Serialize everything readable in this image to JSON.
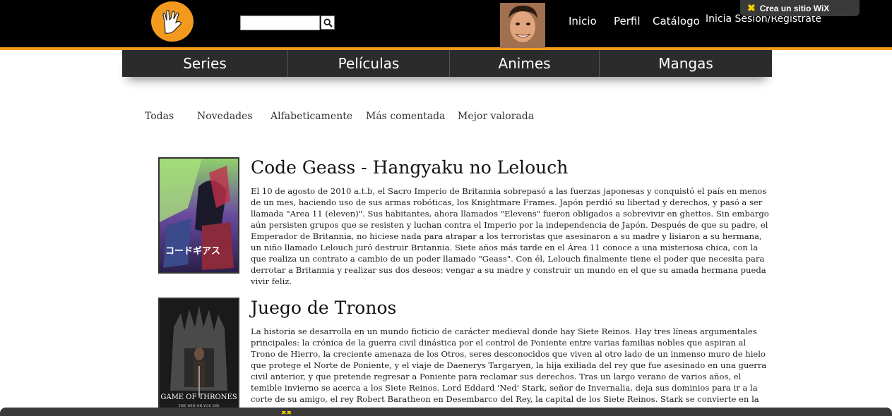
{
  "header": {
    "logo_icon": "vulcan-salute-icon",
    "search": {
      "placeholder": "",
      "value": ""
    },
    "search_icon": "search-icon",
    "avatar_icon": "user-avatar",
    "nav": {
      "inicio": "Inicio",
      "perfil": "Perfil",
      "catalogo": "Catálogo",
      "login": "Inicia Sesión/Regístrate"
    },
    "wix_badge": "Crea un sitio WiX"
  },
  "categories": [
    "Series",
    "Películas",
    "Animes",
    "Mangas"
  ],
  "filters": [
    "Todas",
    "Novedades",
    "Alfabeticamente",
    "Más comentada",
    "Mejor valorada"
  ],
  "entries": [
    {
      "title": "Code Geass - Hangyaku no Lelouch",
      "description": "El 10 de agosto de 2010 a.t.b, el Sacro Imperio de Britannia sobrepasó a las fuerzas japonesas y conquistó el país en menos de un mes, haciendo uso de sus armas robóticas, los Knightmare Frames. Japón perdió su libertad y derechos, y pasó a ser llamada \"Area 11 (eleven)\". Sus habitantes, ahora llamados \"Elevens\" fueron obligados a sobrevivir en ghettos. Sin embargo aún persisten grupos que se resisten y luchan contra el Imperio por la independencia de Japón. Después de que su padre, el Emperador de Britannia, no hiciese nada para atrapar a los terroristas que asesinaron a su madre y lisiaron a su hermana, un niño llamado Lelouch juró destruir Britannia. Siete años más tarde en el Área 11 conoce a una misteriosa chica, con la que realiza un contrato a cambio de un poder llamado \"Geass\". Con él, Lelouch finalmente tiene el poder que necesita para derrotar a Britannia y realizar sus dos deseos: vengar a su madre y construir un mundo en el que su amada hermana pueda vivir feliz."
    },
    {
      "title": "Juego de Tronos",
      "description": "La historia se desarrolla en un mundo ficticio de carácter medieval donde hay Siete Reinos. Hay tres líneas argumentales principales: la crónica de la guerra civil dinástica por el control de Poniente entre varias familias nobles que aspiran al Trono de Hierro, la creciente amenaza de los Otros, seres desconocidos que viven al otro lado de un inmenso muro de hielo que protege el Norte de Poniente, y el viaje de Daenerys Targaryen, la hija exiliada del rey que fue asesinado en una guerra civil anterior, y que pretende regresar a Poniente para reclamar sus derechos. Tras un largo verano de varios años, el temible invierno se acerca a los Siete Reinos. Lord Eddard 'Ned' Stark, señor de Invernalia, deja sus dominios para ir a la corte de su amigo, el rey Robert Baratheon en Desembarco del Rey, la capital de los Siete Reinos. Stark se convierte en la Mano del Rey e intenta desentrañar una maraña de intrigas que pondrá en peligro su vida y la de",
      "poster_text": "GAME OF THRONES",
      "poster_subtext": "THE WIN OR YOU DIE"
    }
  ],
  "colors": {
    "accent": "#f39a1e",
    "header_bg": "#000000",
    "nav_bg": "#2b2b2b",
    "wix_star": "#f5d000"
  }
}
